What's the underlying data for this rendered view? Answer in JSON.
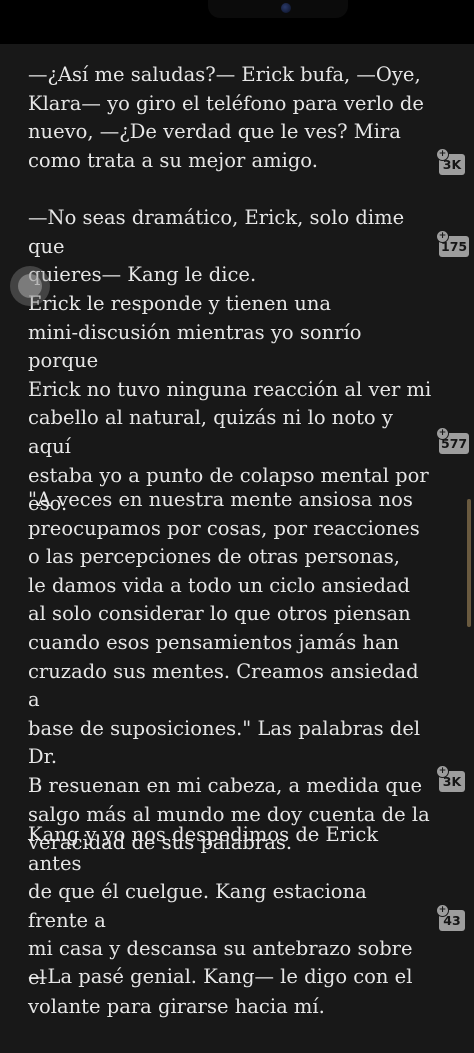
{
  "reader": {
    "paragraphs": [
      {
        "text": "—¿Así me saludas?— Erick bufa, —Oye,\nKlara— yo giro el teléfono para verlo de\nnuevo, —¿De verdad que le ves? Mira\ncomo trata a su mejor amigo.",
        "comments": "3K"
      },
      {
        "text": "—No seas dramático, Erick, solo dime que\nquieres— Kang le dice.",
        "comments": "175"
      },
      {
        "text": "Erick le responde y tienen una\nmini-discusión mientras yo sonrío porque\nErick no tuvo ninguna reacción al ver mi\ncabello al natural, quizás ni lo noto y aquí\nestaba yo a punto de colapso mental por\neso.",
        "comments": "577"
      },
      {
        "text": "\"A veces en nuestra mente ansiosa nos\npreocupamos por cosas, por reacciones\no las percepciones de otras personas,\nle damos vida a todo un ciclo ansiedad\nal solo considerar lo que otros piensan\ncuando esos pensamientos jamás han\ncruzado sus mentes. Creamos ansiedad a\nbase de suposiciones.\" Las palabras del Dr.\nB resuenan en mi cabeza, a medida que\nsalgo más al mundo me doy cuenta de la\nveracidad de sus palabras.",
        "comments": "3K"
      },
      {
        "text": "Kang y yo nos despedimos de Erick antes\nde que él cuelgue. Kang estaciona frente a\nmi casa y descansa su antebrazo sobre el\nvolante para girarse hacia mí.",
        "comments": "43"
      },
      {
        "text": "—La pasé genial. Kang— le digo con el",
        "comments": null
      }
    ],
    "badge_icon": "comment-plus-icon"
  },
  "colors": {
    "page_background": "#181818",
    "text": "#e6e6e6",
    "badge": "#9d9d9d",
    "scroll_thumb": "#6a5a3f"
  }
}
